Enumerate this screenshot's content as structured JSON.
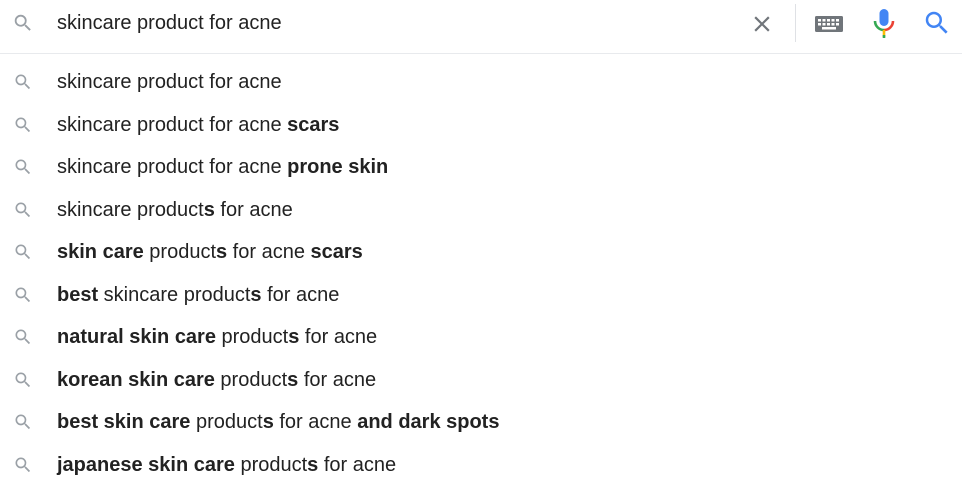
{
  "search": {
    "query": "skincare product for acne",
    "icons": {
      "leading": "search-icon",
      "clear": "close-icon",
      "keyboard": "keyboard-icon",
      "voice": "microphone-icon",
      "submit": "search-icon"
    },
    "colors": {
      "icon_gray": "#9aa0a6",
      "clear_gray": "#70757a",
      "submit_blue": "#4285f4",
      "mic_blue": "#4285f4",
      "mic_red": "#ea4335",
      "mic_yellow": "#fbbc05",
      "mic_green": "#34a853"
    }
  },
  "suggestions": [
    {
      "parts": [
        {
          "text": "skincare product for acne",
          "bold": false
        }
      ]
    },
    {
      "parts": [
        {
          "text": "skincare product for acne ",
          "bold": false
        },
        {
          "text": "scars",
          "bold": true
        }
      ]
    },
    {
      "parts": [
        {
          "text": "skincare product for acne ",
          "bold": false
        },
        {
          "text": "prone skin",
          "bold": true
        }
      ]
    },
    {
      "parts": [
        {
          "text": "skincare product",
          "bold": false
        },
        {
          "text": "s",
          "bold": true
        },
        {
          "text": " for acne",
          "bold": false
        }
      ]
    },
    {
      "parts": [
        {
          "text": "skin care",
          "bold": true
        },
        {
          "text": " product",
          "bold": false
        },
        {
          "text": "s",
          "bold": true
        },
        {
          "text": " for acne ",
          "bold": false
        },
        {
          "text": "scars",
          "bold": true
        }
      ]
    },
    {
      "parts": [
        {
          "text": "best",
          "bold": true
        },
        {
          "text": " skincare product",
          "bold": false
        },
        {
          "text": "s",
          "bold": true
        },
        {
          "text": " for acne",
          "bold": false
        }
      ]
    },
    {
      "parts": [
        {
          "text": "natural skin care",
          "bold": true
        },
        {
          "text": " product",
          "bold": false
        },
        {
          "text": "s",
          "bold": true
        },
        {
          "text": " for acne",
          "bold": false
        }
      ]
    },
    {
      "parts": [
        {
          "text": "korean skin care",
          "bold": true
        },
        {
          "text": " product",
          "bold": false
        },
        {
          "text": "s",
          "bold": true
        },
        {
          "text": " for acne",
          "bold": false
        }
      ]
    },
    {
      "parts": [
        {
          "text": "best skin care",
          "bold": true
        },
        {
          "text": " product",
          "bold": false
        },
        {
          "text": "s",
          "bold": true
        },
        {
          "text": " for acne ",
          "bold": false
        },
        {
          "text": "and dark spots",
          "bold": true
        }
      ]
    },
    {
      "parts": [
        {
          "text": "japanese skin care",
          "bold": true
        },
        {
          "text": " product",
          "bold": false
        },
        {
          "text": "s",
          "bold": true
        },
        {
          "text": " for acne",
          "bold": false
        }
      ]
    }
  ]
}
